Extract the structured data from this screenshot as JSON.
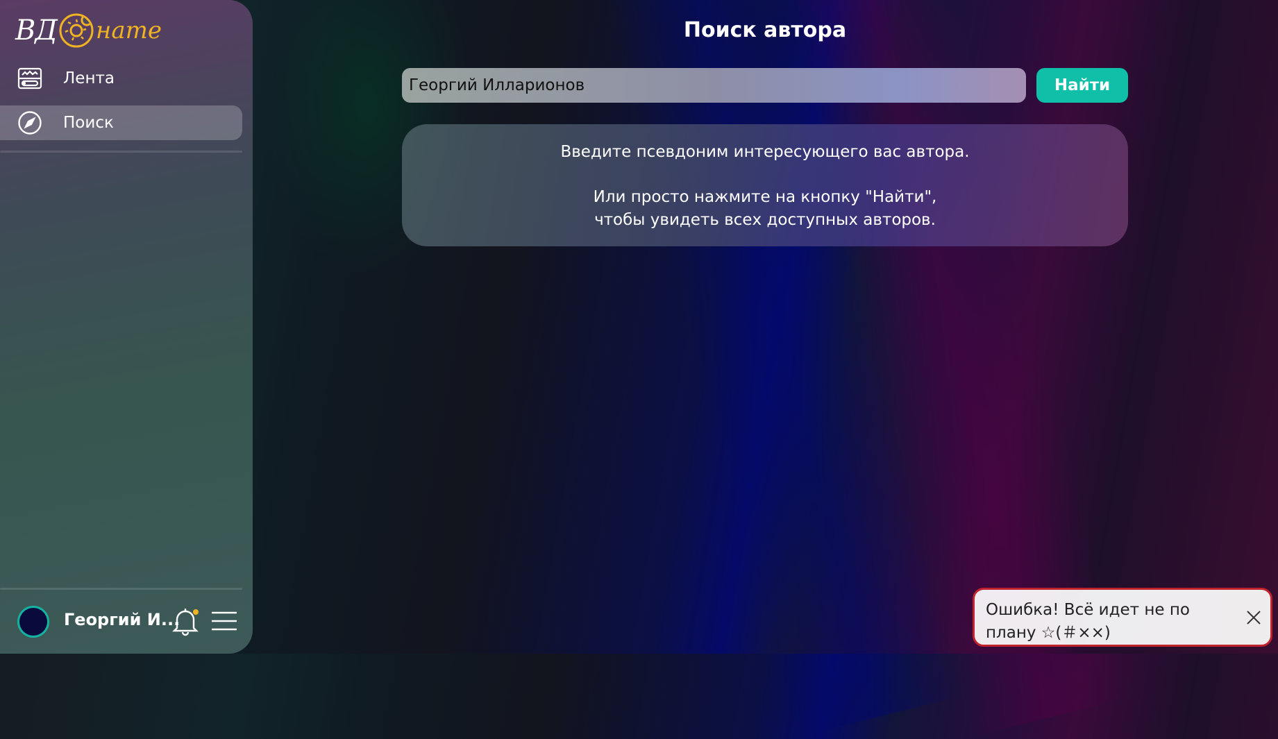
{
  "logo": {
    "part1": "ВД",
    "part2": "нате",
    "icon": "donut-logo-icon",
    "accent": "#f0b323"
  },
  "sidebar": {
    "items": [
      {
        "label": "Лента",
        "icon": "feed-icon",
        "active": false
      },
      {
        "label": "Поиск",
        "icon": "compass-icon",
        "active": true
      }
    ]
  },
  "user": {
    "name": "Георгий И...",
    "notifications_dot_color": "#f0b323"
  },
  "main": {
    "title": "Поиск автора",
    "search": {
      "value": "Георгий Илларионов",
      "placeholder": "",
      "button_label": "Найти"
    },
    "info": {
      "line1": "Введите псевдоним интересующего вас автора.",
      "line2": "Или просто нажмите на кнопку \"Найти\",",
      "line3": "чтобы увидеть всех доступных авторов."
    }
  },
  "toast": {
    "message": "Ошибка! Всё идет не по плану ☆(＃××)",
    "border_color": "#c0232b"
  },
  "colors": {
    "accent": "#10bfa7"
  }
}
